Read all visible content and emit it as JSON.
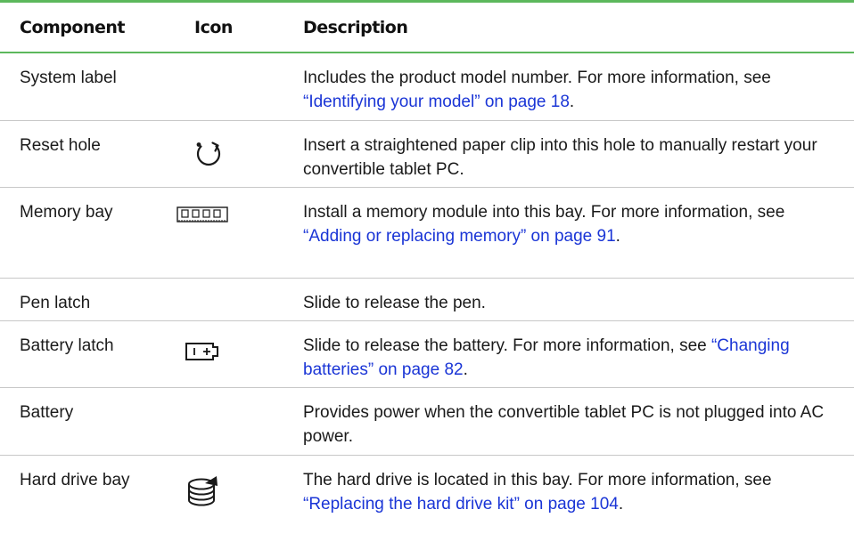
{
  "table": {
    "headers": {
      "component": "Component",
      "icon": "Icon",
      "description": "Description"
    },
    "rows": [
      {
        "component": "System label",
        "icon": "",
        "desc_text": "Includes the product model number. For more information, see ",
        "desc_link": "“Identifying your model” on page 18",
        "desc_tail": "."
      },
      {
        "component": "Reset hole",
        "icon": "reset-icon",
        "desc_text": "Insert a straightened paper clip into this hole to manually restart your convertible tablet PC.",
        "desc_link": "",
        "desc_tail": ""
      },
      {
        "component": "Memory bay",
        "icon": "memory-module-icon",
        "desc_text": "Install a memory module into this bay. For more information, see ",
        "desc_link": "“Adding or replacing memory” on page 91",
        "desc_tail": "."
      },
      {
        "component": "Pen latch",
        "icon": "",
        "desc_text": "Slide to release the pen.",
        "desc_link": "",
        "desc_tail": ""
      },
      {
        "component": "Battery latch",
        "icon": "battery-icon",
        "desc_text": "Slide to release the battery. For more information, see ",
        "desc_link": "“Changing batteries” on page 82",
        "desc_tail": "."
      },
      {
        "component": "Battery",
        "icon": "",
        "desc_text": "Provides power when the convertible tablet PC is not plugged into AC power.",
        "desc_link": "",
        "desc_tail": ""
      },
      {
        "component": "Hard drive bay",
        "icon": "hard-drive-icon",
        "desc_text": "The hard drive is located in this bay. For more information, see ",
        "desc_link": "“Replacing the hard drive kit” on page 104",
        "desc_tail": "."
      }
    ]
  },
  "colors": {
    "rule": "#5cb85c",
    "link": "#1a35d6"
  }
}
